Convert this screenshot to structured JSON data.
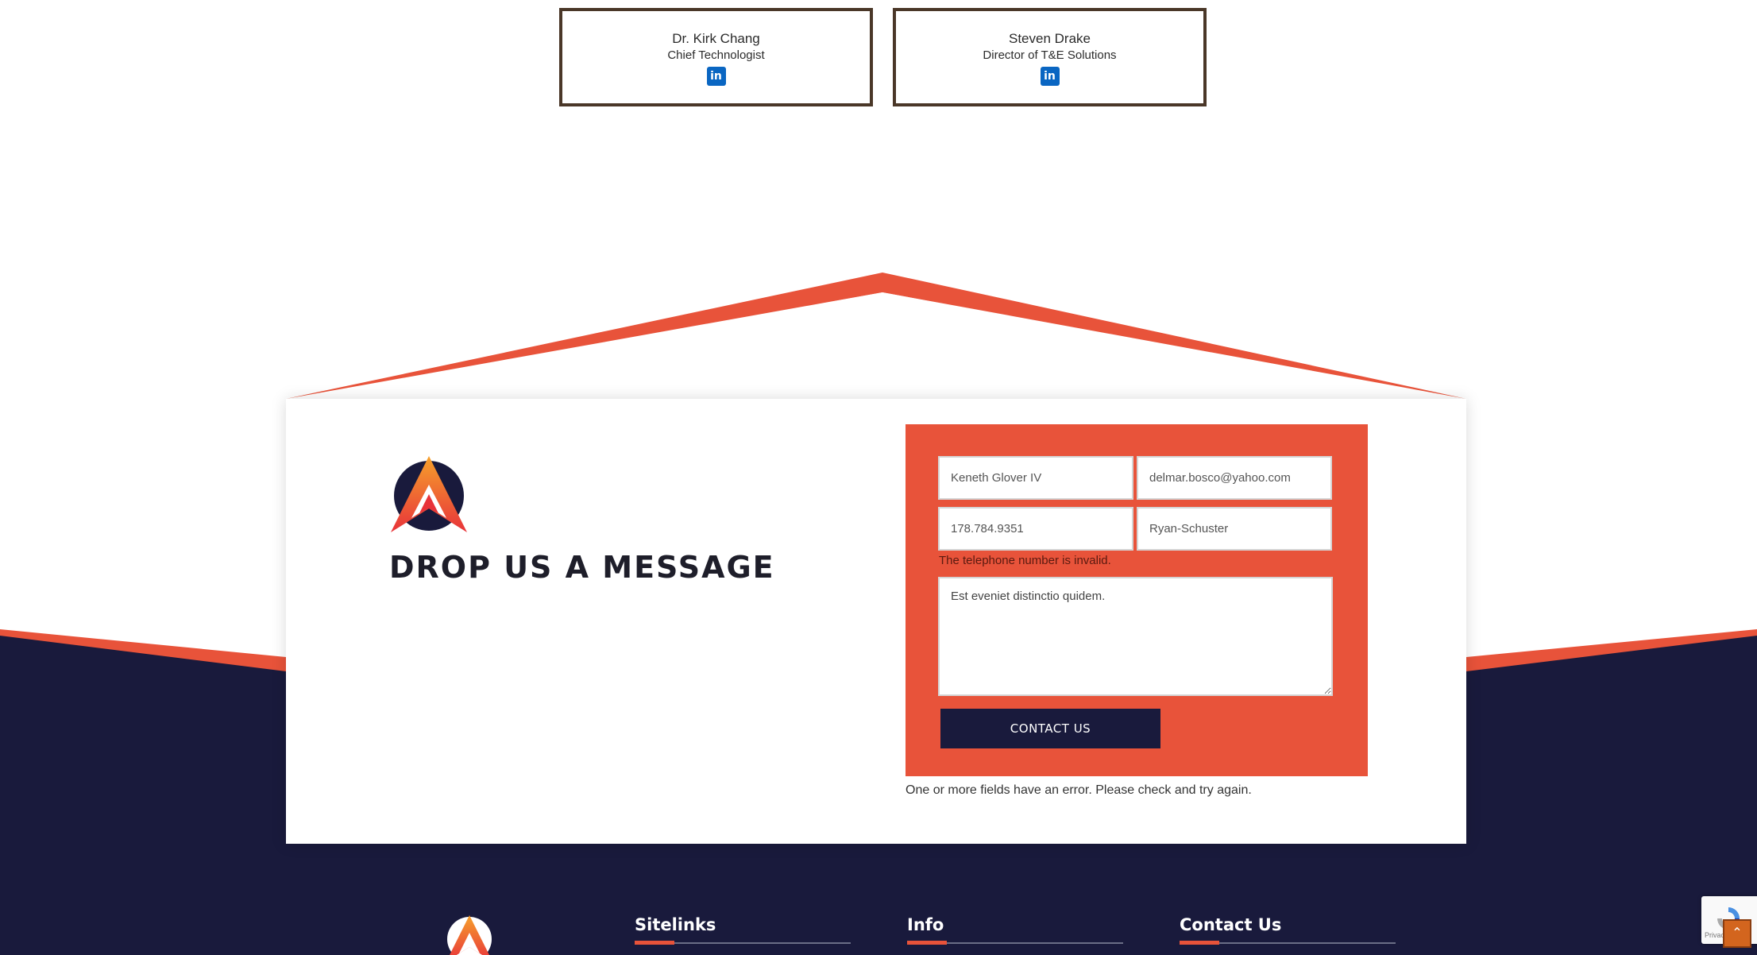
{
  "team": [
    {
      "name": "Dr. Kirk Chang",
      "role": "Chief Technologist",
      "social_icon": "linkedin-icon"
    },
    {
      "name": "Steven Drake",
      "role": "Director of T&E Solutions",
      "social_icon": "linkedin-icon"
    }
  ],
  "contact_section": {
    "heading": "DROP US A MESSAGE",
    "form": {
      "name_value": "Keneth Glover IV",
      "email_value": "delmar.bosco@yahoo.com",
      "phone_value": "178.784.9351",
      "company_value": "Ryan-Schuster",
      "phone_error": "The telephone number is invalid.",
      "message_value": "Est eveniet distinctio quidem.",
      "submit_label": "CONTACT US",
      "status_message": "One or more fields have an error. Please check and try again."
    }
  },
  "footer": {
    "columns": [
      {
        "heading": "Sitelinks"
      },
      {
        "heading": "Info"
      },
      {
        "heading": "Contact Us"
      }
    ]
  },
  "recaptcha": {
    "text": "Privacy"
  },
  "back_to_top": {
    "icon": "chevron-up-icon"
  },
  "colors": {
    "accent": "#e8533a",
    "navy": "#191a3c",
    "card_border": "#4a3728",
    "linkedin": "#0a66c2"
  }
}
